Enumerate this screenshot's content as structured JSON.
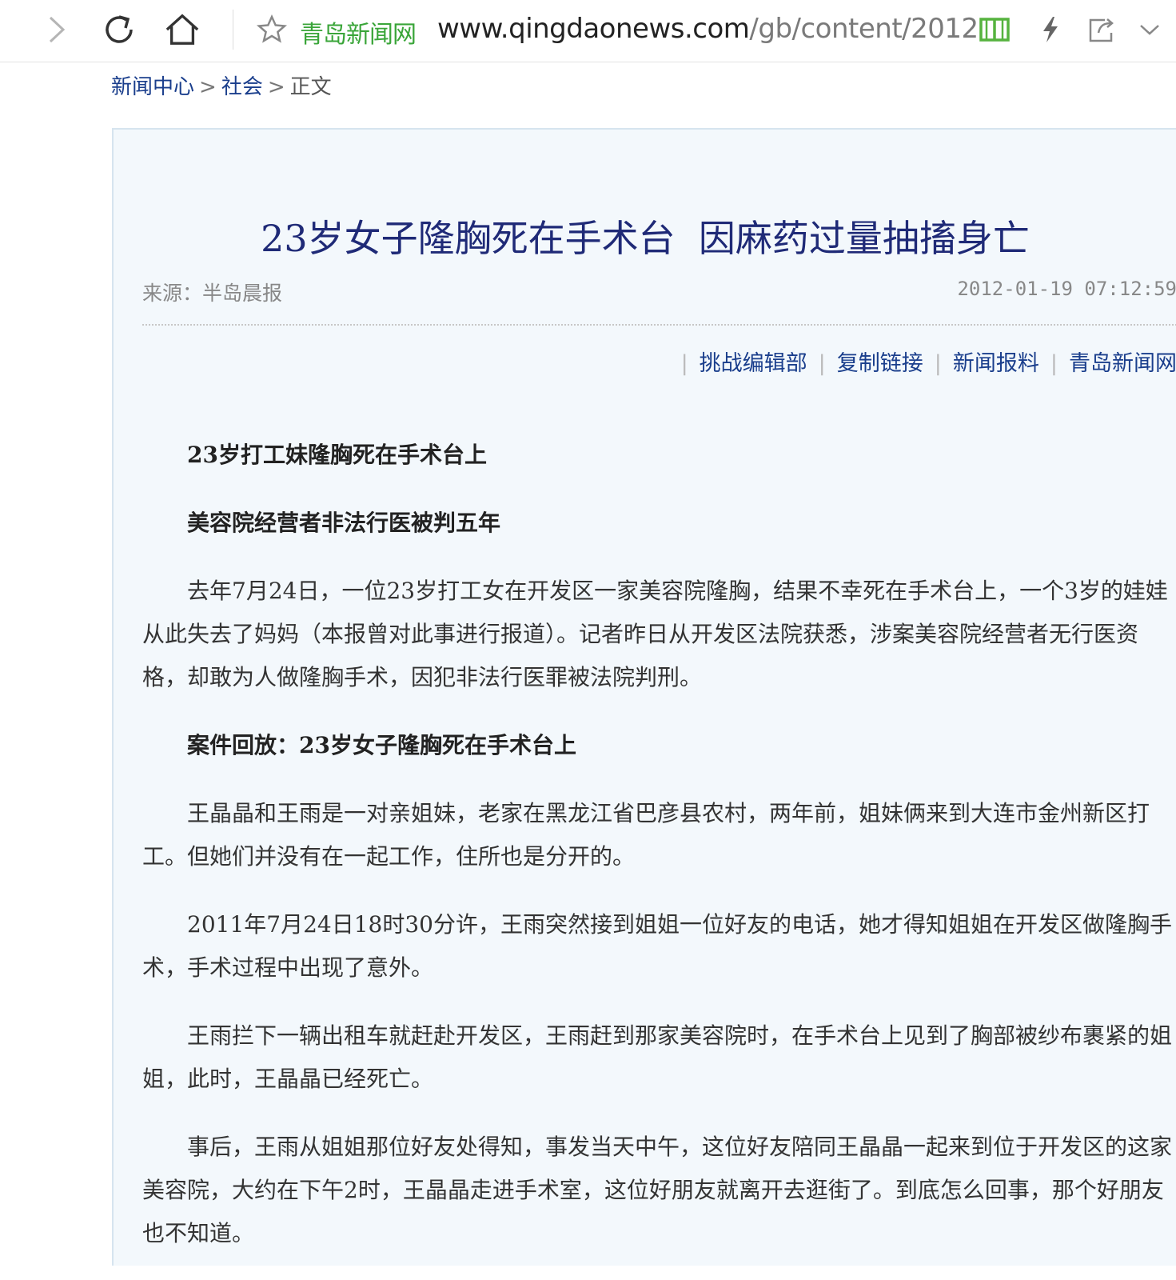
{
  "browser": {
    "site_name": "青岛新闻网",
    "url_host": "www.qingdaonews.com",
    "url_path": "/gb/content/2012",
    "icons": [
      "forward-icon",
      "reload-icon",
      "home-icon",
      "bookmark-star-icon",
      "reader-mode-icon",
      "lightning-icon",
      "share-icon",
      "chevron-down-icon"
    ]
  },
  "breadcrumb": {
    "item1": "新闻中心",
    "sep1": ">",
    "item2": "社会",
    "sep2": ">",
    "current": "正文"
  },
  "article": {
    "title": "23岁女子隆胸死在手术台  因麻药过量抽搐身亡",
    "source": "来源：半岛晨报",
    "time": "2012-01-19 07:12:59",
    "actions": [
      "挑战编辑部",
      "复制链接",
      "新闻报料",
      "青岛新闻网"
    ],
    "paragraphs": [
      "23岁打工妹隆胸死在手术台上",
      "美容院经营者非法行医被判五年",
      "去年7月24日，一位23岁打工女在开发区一家美容院隆胸，结果不幸死在手术台上，一个3岁的娃娃从此失去了妈妈（本报曾对此事进行报道）。记者昨日从开发区法院获悉，涉案美容院经营者无行医资格，却敢为人做隆胸手术，因犯非法行医罪被法院判刑。",
      "案件回放：23岁女子隆胸死在手术台上",
      "王晶晶和王雨是一对亲姐妹，老家在黑龙江省巴彦县农村，两年前，姐妹俩来到大连市金州新区打工。但她们并没有在一起工作，住所也是分开的。",
      "2011年7月24日18时30分许，王雨突然接到姐姐一位好友的电话，她才得知姐姐在开发区做隆胸手术，手术过程中出现了意外。",
      "王雨拦下一辆出租车就赶赴开发区，王雨赶到那家美容院时，在手术台上见到了胸部被纱布裹紧的姐姐，此时，王晶晶已经死亡。",
      "事后，王雨从姐姐那位好友处得知，事发当天中午，这位好友陪同王晶晶一起来到位于开发区的这家美容院，大约在下午2时，王晶晶走进手术室，这位好朋友就离开去逛街了。到底怎么回事，那个好朋友也不知道。"
    ]
  }
}
